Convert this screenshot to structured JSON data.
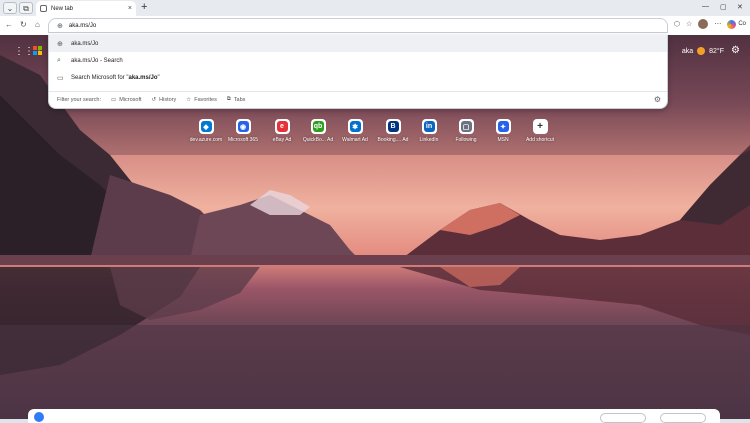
{
  "browser": {
    "tab_title": "New tab",
    "tab_close": "×",
    "new_tab": "+",
    "address_value": "aka.ms/Jo",
    "copilot_label": "Co"
  },
  "dropdown": {
    "suggestions": [
      {
        "text": "aka.ms/Jo",
        "icon": "globe-icon"
      },
      {
        "text": "aka.ms/Jo - Search",
        "icon": "search-icon"
      },
      {
        "prefix": "Search Microsoft for \"",
        "bold": "aka.ms/Jo",
        "suffix": "\"",
        "icon": "briefcase-icon"
      }
    ],
    "filter_label": "Filter your search:",
    "filters": [
      "Microsoft",
      "History",
      "Favorites",
      "Tabs"
    ]
  },
  "header": {
    "weather_prefix": "aka",
    "temperature": "82°F"
  },
  "quick_links": [
    {
      "label": "dev.azure.com",
      "color": "#0078d4",
      "glyph": "◆"
    },
    {
      "label": "Microsoft 365",
      "color": "#2563eb",
      "glyph": "◉"
    },
    {
      "label": "eBay",
      "ad": "Ad",
      "color": "#e53238",
      "glyph": "e"
    },
    {
      "label": "QuickBo...",
      "ad": "Ad",
      "color": "#2ca01c",
      "glyph": "qb"
    },
    {
      "label": "Walmart",
      "ad": "Ad",
      "color": "#0071ce",
      "glyph": "✱"
    },
    {
      "label": "Booking....",
      "ad": "Ad",
      "color": "#003580",
      "glyph": "B"
    },
    {
      "label": "LinkedIn",
      "color": "#0a66c2",
      "glyph": "in"
    },
    {
      "label": "Following",
      "color": "#6b7280",
      "glyph": "▢"
    },
    {
      "label": "MSN",
      "color": "#2563eb",
      "glyph": "✦"
    },
    {
      "label": "Add shortcut",
      "color": "#ffffff",
      "glyph": "+"
    }
  ],
  "colors": {
    "ms_logo": [
      "#f25022",
      "#7fba00",
      "#00a4ef",
      "#ffb900"
    ],
    "weather_sun": "#f3a02a"
  }
}
